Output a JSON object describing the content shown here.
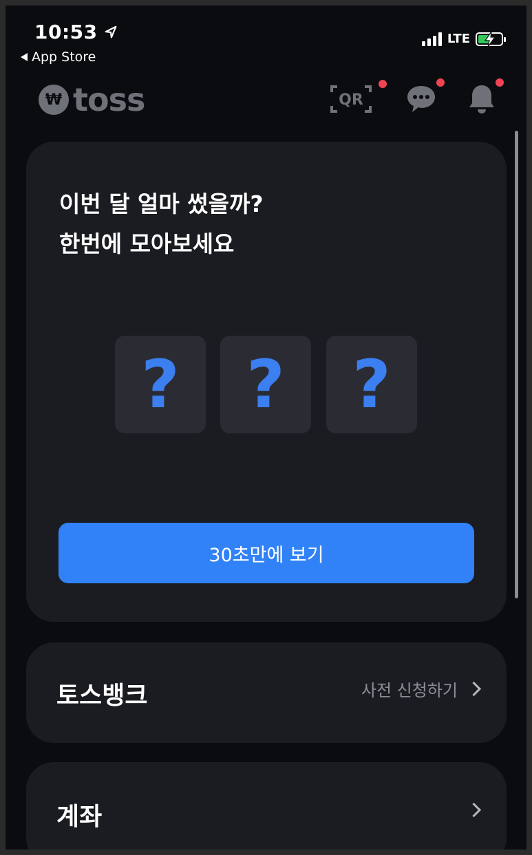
{
  "status_bar": {
    "time": "10:53",
    "back_label": "App Store",
    "network": "LTE",
    "battery_level": 0.6,
    "battery_color": "#34c759"
  },
  "header": {
    "logo_text": "toss",
    "logo_mark": "₩",
    "qr_label": "QR",
    "icons": [
      "qr-scan-icon",
      "chat-icon",
      "bell-icon"
    ],
    "notification_dot_color": "#f04452"
  },
  "summary_card": {
    "title_line1": "이번 달 얼마 썼을까?",
    "title_line2": "한번에 모아보세요",
    "placeholders": [
      "?",
      "?",
      "?"
    ],
    "cta_label": "30초만에 보기",
    "accent_color": "#3182f6"
  },
  "rows": {
    "bank": {
      "title": "토스뱅크",
      "action_label": "사전 신청하기"
    },
    "account": {
      "title": "계좌"
    }
  }
}
